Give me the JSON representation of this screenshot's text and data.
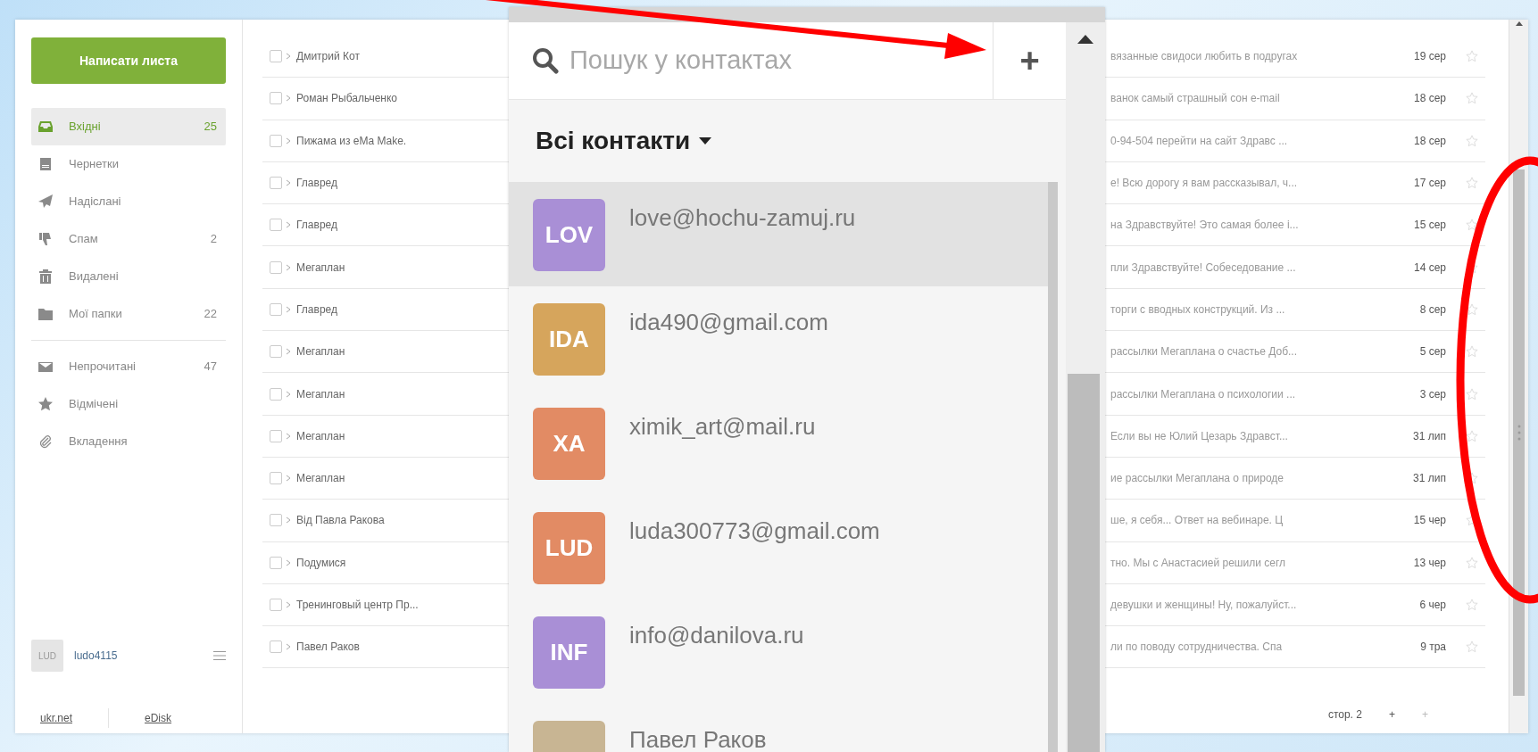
{
  "compose_button": "Написати листа",
  "folders": [
    {
      "label": "Вхідні",
      "count": "25",
      "selected": true
    },
    {
      "label": "Чернетки",
      "selected": false
    },
    {
      "label": "Надіслані",
      "selected": false
    },
    {
      "label": "Спам",
      "count": "2",
      "selected": false
    },
    {
      "label": "Видалені",
      "selected": false
    },
    {
      "label": "Мої папки",
      "count": "22",
      "selected": false
    }
  ],
  "filters": [
    {
      "label": "Непрочитані",
      "count": "47",
      "selected": false
    },
    {
      "label": "Відмічені",
      "selected": false
    },
    {
      "label": "Вкладення",
      "selected": false
    }
  ],
  "account": {
    "avatar": "LUD",
    "username": "ludo4115"
  },
  "footer_links": [
    "ukr.net",
    "eDisk"
  ],
  "messages": [
    {
      "sender": "Дмитрий Кот",
      "subject": "вязанные свидоси любить в подругах",
      "date": "19 сер",
      "checked": false,
      "starred": false
    },
    {
      "sender": "Роман Рыбальченко",
      "subject": "ванок самый страшный сон e-mail",
      "date": "18 сер",
      "checked": false,
      "starred": false
    },
    {
      "sender": "Пижама из eMa Make.",
      "subject": "0-94-504 перейти на сайт Здравс ...",
      "date": "18 сер",
      "checked": false,
      "starred": false
    },
    {
      "sender": "Главред",
      "subject": "е! Всю дорогу я вам рассказывал, ч...",
      "date": "17 сер",
      "checked": false,
      "starred": false
    },
    {
      "sender": "Главред",
      "subject": "на Здравствуйте! Это самая более і...",
      "date": "15 сер",
      "checked": false,
      "starred": false
    },
    {
      "sender": "Мегаплан",
      "subject": "пли Здравствуйте! Собеседование ...",
      "date": "14 сер",
      "checked": false,
      "starred": false
    },
    {
      "sender": "Главред",
      "subject": "торги с вводных конструкций. Из ...",
      "date": "8 сер",
      "checked": false,
      "starred": false
    },
    {
      "sender": "Мегаплан",
      "subject": "рассылки Мегаплана о счастье Доб...",
      "date": "5 сер",
      "checked": false,
      "starred": false
    },
    {
      "sender": "Мегаплан",
      "subject": "рассылки Мегаплана о психологии ...",
      "date": "3 сер",
      "checked": false,
      "starred": false
    },
    {
      "sender": "Мегаплан",
      "subject": "Если вы не Юлий Цезарь Здравст...",
      "date": "31 лип",
      "checked": false,
      "starred": false
    },
    {
      "sender": "Мегаплан",
      "subject": "ие рассылки Мегаплана о природе",
      "date": "31 лип",
      "checked": false,
      "starred": false
    },
    {
      "sender": "Від Павла Ракова",
      "subject": "ше, я себя... Ответ на вебинаре. Ц",
      "date": "15 чер",
      "checked": false,
      "starred": false
    },
    {
      "sender": "Подумися",
      "subject": "тно. Мы с Анастасией решили сегл",
      "date": "13 чер",
      "checked": false,
      "starred": false
    },
    {
      "sender": "Тренинговый центр Пр...",
      "subject": "девушки и женщины! Ну, пожалуйст...",
      "date": "6 чер",
      "checked": false,
      "starred": false
    },
    {
      "sender": "Павел Раков",
      "subject": "ли по поводу сотрудничества. Спа",
      "date": "9 тра",
      "checked": false,
      "starred": false
    }
  ],
  "pagination": {
    "page": "стор. 2",
    "next": "+",
    "last": "+"
  },
  "contacts_panel": {
    "search": {
      "placeholder": "Пошук у контактах"
    },
    "add_button": "+",
    "filter": "Всі контакти",
    "contacts": [
      {
        "initials": "LOV",
        "name": "love@hochu-zamuj.ru",
        "color": "#a98fd6",
        "selected": true
      },
      {
        "initials": "IDA",
        "name": "ida490@gmail.com",
        "color": "#d6a55c",
        "selected": false
      },
      {
        "initials": "XA",
        "name": "ximik_art@mail.ru",
        "color": "#e28b64",
        "selected": false
      },
      {
        "initials": "LUD",
        "name": "luda300773@gmail.com",
        "color": "#e28b64",
        "selected": false
      },
      {
        "initials": "INF",
        "name": "info@danilova.ru",
        "color": "#a98fd6",
        "selected": false
      },
      {
        "name": "Павел Раков",
        "color": "#c8b593",
        "selected": false
      }
    ]
  }
}
